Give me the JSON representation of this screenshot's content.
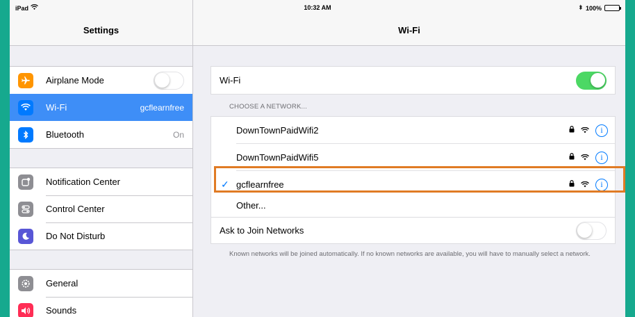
{
  "status_bar": {
    "device": "iPad",
    "time": "10:32 AM",
    "battery": "100%"
  },
  "sidebar": {
    "title": "Settings",
    "groups": [
      {
        "items": [
          {
            "label": "Airplane Mode",
            "value": "",
            "icon": "airplane-icon",
            "icon_color": "#ff9500",
            "toggle": "off",
            "selected": false
          },
          {
            "label": "Wi-Fi",
            "value": "gcflearnfree",
            "icon": "wifi-icon",
            "icon_color": "#007aff",
            "selected": true
          },
          {
            "label": "Bluetooth",
            "value": "On",
            "icon": "bluetooth-icon",
            "icon_color": "#007aff",
            "selected": false
          }
        ]
      },
      {
        "items": [
          {
            "label": "Notification Center",
            "icon": "notification-center-icon",
            "icon_color": "#8e8e93"
          },
          {
            "label": "Control Center",
            "icon": "control-center-icon",
            "icon_color": "#8e8e93"
          },
          {
            "label": "Do Not Disturb",
            "icon": "moon-icon",
            "icon_color": "#5856d6"
          }
        ]
      },
      {
        "items": [
          {
            "label": "General",
            "icon": "gear-icon",
            "icon_color": "#8e8e93"
          },
          {
            "label": "Sounds",
            "icon": "speaker-icon",
            "icon_color": "#ff2d55"
          }
        ]
      }
    ]
  },
  "main": {
    "title": "Wi-Fi",
    "wifi_label": "Wi-Fi",
    "wifi_toggle": "on",
    "section_label": "CHOOSE A NETWORK...",
    "networks": [
      {
        "name": "DownTownPaidWifi2",
        "locked": true,
        "connected": false
      },
      {
        "name": "DownTownPaidWifi5",
        "locked": true,
        "connected": false
      },
      {
        "name": "gcflearnfree",
        "locked": true,
        "connected": true
      }
    ],
    "other_label": "Other...",
    "ask_label": "Ask to Join Networks",
    "ask_toggle": "off",
    "footnote": "Known networks will be joined automatically. If no known networks are available, you will have to manually select a network."
  },
  "colors": {
    "accent": "#007aff",
    "toggle_on": "#4cd864",
    "highlight_border": "#e07b24",
    "background": "#16a98e"
  }
}
